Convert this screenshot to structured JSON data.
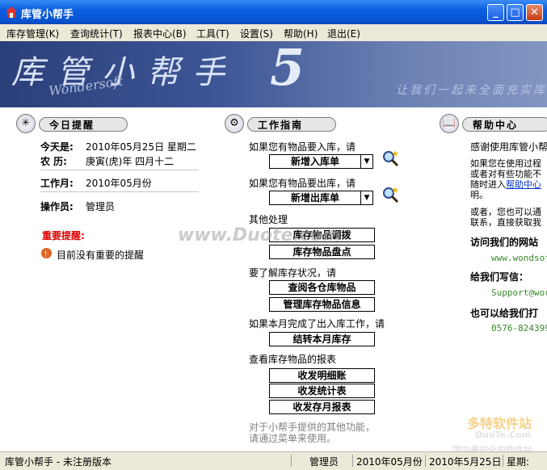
{
  "window": {
    "title": "库管小帮手"
  },
  "menu": [
    "库存管理(K)",
    "查询统计(T)",
    "报表中心(B)",
    "工具(T)",
    "设置(S)",
    "帮助(H)",
    "退出(E)"
  ],
  "banner": {
    "title": "库管小帮手",
    "version": "5",
    "brand": "Wondersoft",
    "slogan": "让我们一起来全面充实库"
  },
  "today": {
    "header": "今日提醒",
    "date_label": "今天是:",
    "date_value": "2010年05月25日   星期二",
    "lunar_label": "农   历:",
    "lunar_value": "庚寅(虎)年  四月十二",
    "month_label": "工作月:",
    "month_value": "2010年05月份",
    "operator_label": "操作员:",
    "operator_value": "管理员",
    "important_label": "重要提醒:",
    "important_text": "目前没有重要的提醒"
  },
  "guide": {
    "header": "工作指南",
    "q_in": "如果您有物品要入库，请",
    "btn_in": "新增入库单",
    "q_out": "如果您有物品要出库，请",
    "btn_out": "新增出库单",
    "other": "其他处理",
    "btn_transfer": "库存物品调拨",
    "btn_check": "库存物品盘点",
    "q_status": "要了解库存状况，请",
    "btn_view": "查阅各仓库物品",
    "btn_manage": "管理库存物品信息",
    "q_month": "如果本月完成了出入库工作，请",
    "btn_close": "结转本月库存",
    "reports_label": "查看库存物品的报表",
    "btn_detail": "收发明细账",
    "btn_stats": "收发统计表",
    "btn_monthly": "收发存月报表",
    "footer1": "对于小帮手提供的其他功能，",
    "footer2": "请通过菜单来使用。"
  },
  "help": {
    "header": "帮助中心",
    "p1": "感谢使用库管小帮",
    "p2a": "如果您在使用过程",
    "p2b": "或者对有些功能不",
    "p2c_pre": "随时进入",
    "p2c_link": "帮助中心",
    "p2d": "明。",
    "p3a": "或者，您也可以通",
    "p3b": "联系，直接获取我",
    "visit_label": "访问我们的网站",
    "site": "www.wondsof",
    "write_label": "给我们写信：",
    "email": "Support@wor",
    "call_label": "也可以给我们打",
    "phone": "0576-824399"
  },
  "status": {
    "app": "库管小帮手 - 未注册版本",
    "operator": "管理员",
    "month": "2010年05月份",
    "date": "2010年5月25日",
    "weekday": "星期:"
  },
  "watermark": {
    "site": "www.Duote.com",
    "logo": "多特软件站",
    "logo_en": "DuoTe.Com",
    "tagline": "国内最安全的软件站"
  }
}
